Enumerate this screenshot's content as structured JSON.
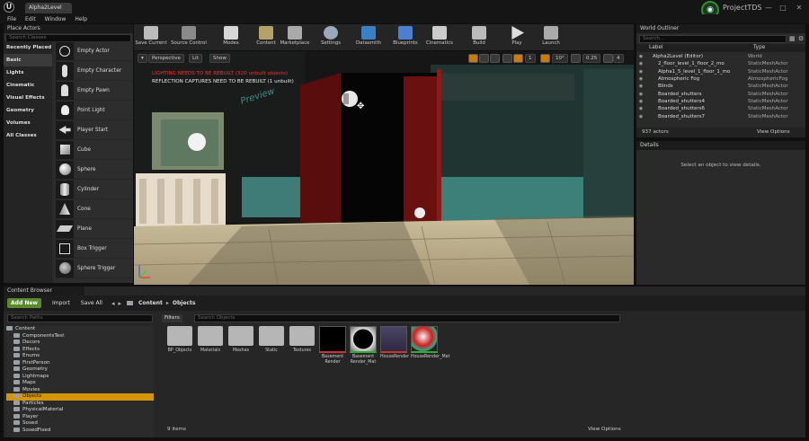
{
  "window": {
    "level_tab": "Alpha2Level",
    "project": "ProjectTDS",
    "minimize": "—",
    "maximize": "□",
    "close": "✕",
    "logo": "U"
  },
  "menu": [
    "File",
    "Edit",
    "Window",
    "Help"
  ],
  "place_actors": {
    "title": "Place Actors",
    "search_placeholder": "Search Classes",
    "categories": [
      "Recently Placed",
      "Basic",
      "Lights",
      "Cinematic",
      "Visual Effects",
      "Geometry",
      "Volumes",
      "All Classes"
    ],
    "active_category": "Basic",
    "items": [
      "Empty Actor",
      "Empty Character",
      "Empty Pawn",
      "Point Light",
      "Player Start",
      "Cube",
      "Sphere",
      "Cylinder",
      "Cone",
      "Plane",
      "Box Trigger",
      "Sphere Trigger"
    ]
  },
  "toolbar": [
    "Save Current",
    "Source Control",
    "Modes",
    "Content",
    "Marketplace",
    "Settings",
    "Datasmith",
    "Blueprints",
    "Cinematics",
    "Build",
    "Play",
    "Launch"
  ],
  "viewport": {
    "perspective": "Perspective",
    "lit": "Lit",
    "show": "Show",
    "grid_value": "1",
    "angle_value": "10°",
    "scale_value": "0.25",
    "camera_value": "4",
    "warn_lighting": "LIGHTING NEEDS TO BE REBUILT (320 unbuilt objects)",
    "warn_reflection": "REFLECTION CAPTURES NEED TO BE REBUILT (1 unbuilt)",
    "preview": "Preview"
  },
  "outliner": {
    "title": "World Outliner",
    "search_placeholder": "Search...",
    "col_label": "Label",
    "col_type": "Type",
    "rows": [
      {
        "name": "Alpha2Level (Editor)",
        "type": "World"
      },
      {
        "name": "2_floor_level_1_floor_2_mo",
        "type": "StaticMeshActor"
      },
      {
        "name": "Alpha1_5_level_1_floor_1_mo",
        "type": "StaticMeshActor"
      },
      {
        "name": "Atmospheric Fog",
        "type": "AtmosphericFog"
      },
      {
        "name": "Blinds",
        "type": "StaticMeshActor"
      },
      {
        "name": "Boarded_shutters",
        "type": "StaticMeshActor"
      },
      {
        "name": "Boarded_shutters4",
        "type": "StaticMeshActor"
      },
      {
        "name": "Boarded_shutters6",
        "type": "StaticMeshActor"
      },
      {
        "name": "Boarded_shutters7",
        "type": "StaticMeshActor"
      }
    ],
    "count": "937 actors",
    "view_options": "View Options"
  },
  "details": {
    "title": "Details",
    "empty": "Select an object to view details."
  },
  "content_browser": {
    "title": "Content Browser",
    "add_new": "Add New",
    "import": "Import",
    "save_all": "Save All",
    "path": [
      "Content",
      "Objects"
    ],
    "search_paths_placeholder": "Search Paths",
    "filters": "Filters",
    "search_objects_placeholder": "Search Objects",
    "tree": [
      "Content",
      "ComponentsTest",
      "Decors",
      "Effects",
      "Enums",
      "FirstPerson",
      "Geometry",
      "Lightmaps",
      "Maps",
      "Movies",
      "Objects",
      "Particles",
      "PhysicalMaterial",
      "Player",
      "Sosed",
      "SosedFixed"
    ],
    "selected_folder": "Objects",
    "folders": [
      "BP_Objects",
      "Materials",
      "Meshes",
      "Static",
      "Textures"
    ],
    "assets": [
      "Basement Render",
      "Basement Render_Mat",
      "HouseRender",
      "HouseRender_Mat"
    ],
    "count": "9 items",
    "view_options": "View Options"
  }
}
